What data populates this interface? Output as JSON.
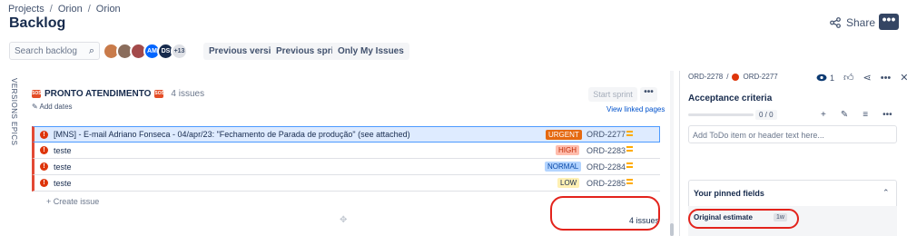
{
  "breadcrumb": [
    "Projects",
    "Orion",
    "Orion"
  ],
  "page_title": "Backlog",
  "header": {
    "share_label": "Share",
    "more_label": "•••"
  },
  "toolbar": {
    "search_placeholder": "Search backlog",
    "avatars": [
      {
        "initials": "",
        "color": "#c97b4a"
      },
      {
        "initials": "",
        "color": "#8a6d5c"
      },
      {
        "initials": "",
        "color": "#a34a4a"
      },
      {
        "initials": "AM",
        "color": "#0065ff"
      },
      {
        "initials": "DS",
        "color": "#172b4d"
      },
      {
        "initials": "+13",
        "color": "#dfe1e6"
      }
    ],
    "filters": [
      "Previous version",
      "Previous sprint",
      "Only My Issues"
    ]
  },
  "side_tabs": [
    "VERSIONS",
    "EPICS"
  ],
  "sprint": {
    "name": "PRONTO ATENDIMENTO",
    "issue_count": "4 issues",
    "add_dates": "Add dates",
    "start_sprint": "Start sprint",
    "more": "•••",
    "view_linked": "View linked pages",
    "create_issue": "Create issue",
    "footer_count": "4 issues"
  },
  "issues": [
    {
      "summary": "[MNS] - E-mail Adriano Fonseca - 04/apr/23: \"Fechamento de Parada de produção\" (see attached)",
      "label": "URGENT",
      "label_bg": "#e56910",
      "label_fg": "#ffffff",
      "key": "ORD-2277"
    },
    {
      "summary": "teste",
      "label": "HIGH",
      "label_bg": "#ffbdad",
      "label_fg": "#bf2600",
      "key": "ORD-2283"
    },
    {
      "summary": "teste",
      "label": "NORMAL",
      "label_bg": "#b3d4ff",
      "label_fg": "#0747a6",
      "key": "ORD-2284"
    },
    {
      "summary": "teste",
      "label": "LOW",
      "label_bg": "#fff0b3",
      "label_fg": "#172b4d",
      "key": "ORD-2285"
    }
  ],
  "detail": {
    "parent_key": "ORD-2278",
    "issue_key": "ORD-2277",
    "watch_count": "1",
    "acceptance_title": "Acceptance criteria",
    "progress_label": "0 / 0",
    "progress": 0,
    "todo_placeholder": "Add ToDo item or header text here...",
    "pinned_title": "Your pinned fields",
    "original_estimate_label": "Original estimate",
    "original_estimate_value": "1w"
  }
}
